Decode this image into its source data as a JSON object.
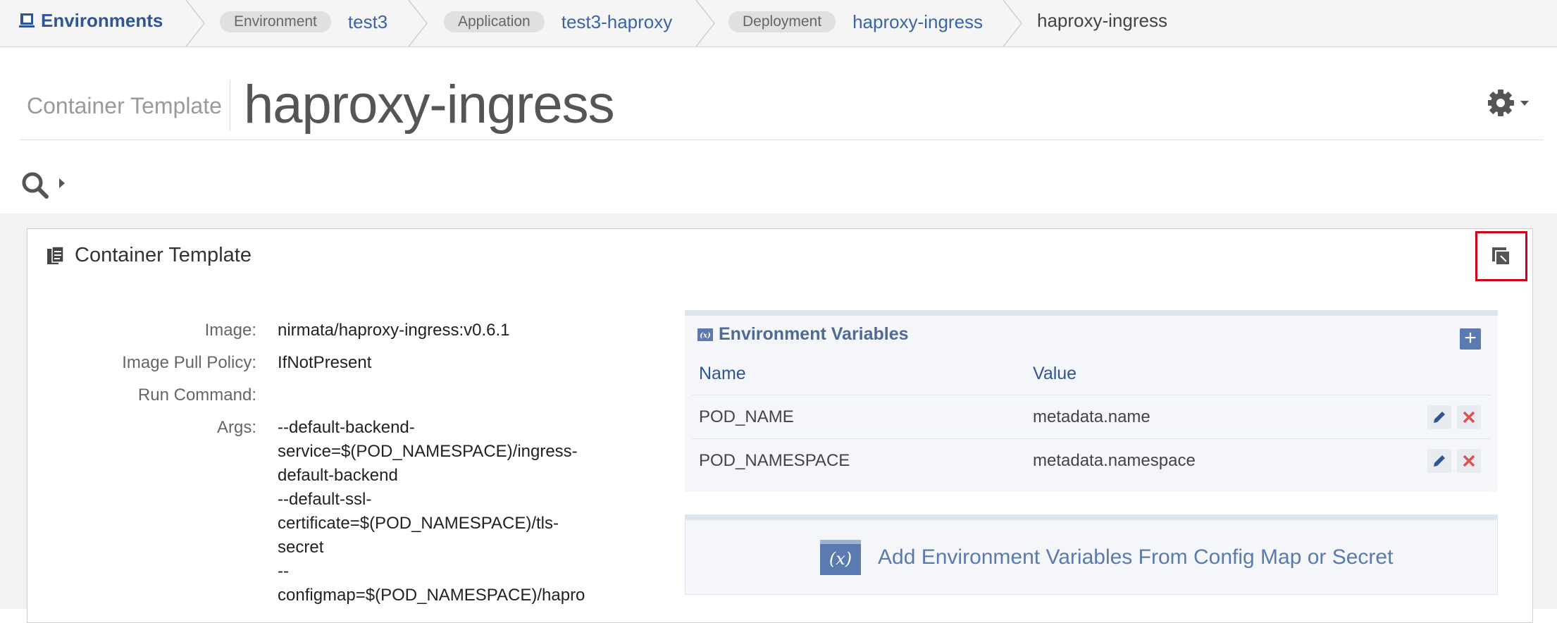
{
  "breadcrumb": {
    "root": "Environments",
    "items": [
      {
        "type": "Environment",
        "value": "test3"
      },
      {
        "type": "Application",
        "value": "test3-haproxy"
      },
      {
        "type": "Deployment",
        "value": "haproxy-ingress"
      }
    ],
    "current": "haproxy-ingress"
  },
  "header": {
    "subtitle": "Container Template",
    "title": "haproxy-ingress"
  },
  "panel": {
    "title": "Container Template"
  },
  "fields": [
    {
      "label": "Image:",
      "value": "nirmata/haproxy-ingress:v0.6.1"
    },
    {
      "label": "Image Pull Policy:",
      "value": "IfNotPresent"
    },
    {
      "label": "Run Command:",
      "value": ""
    },
    {
      "label": "Args:",
      "value": ""
    }
  ],
  "args_lines": [
    "--default-backend-",
    "service=$(POD_NAMESPACE)/ingress-",
    "default-backend",
    "--default-ssl-",
    "certificate=$(POD_NAMESPACE)/tls-",
    "secret",
    "--",
    "configmap=$(POD_NAMESPACE)/hapro"
  ],
  "env": {
    "title": "Environment Variables",
    "columns": [
      "Name",
      "Value"
    ],
    "rows": [
      {
        "name": "POD_NAME",
        "value": "metadata.name"
      },
      {
        "name": "POD_NAMESPACE",
        "value": "metadata.namespace"
      }
    ]
  },
  "config_map": {
    "label": "Add Environment Variables From Config Map or Secret"
  },
  "colors": {
    "link": "#3b64a8",
    "highlight": "#d0021b",
    "delete": "#d9534f"
  }
}
